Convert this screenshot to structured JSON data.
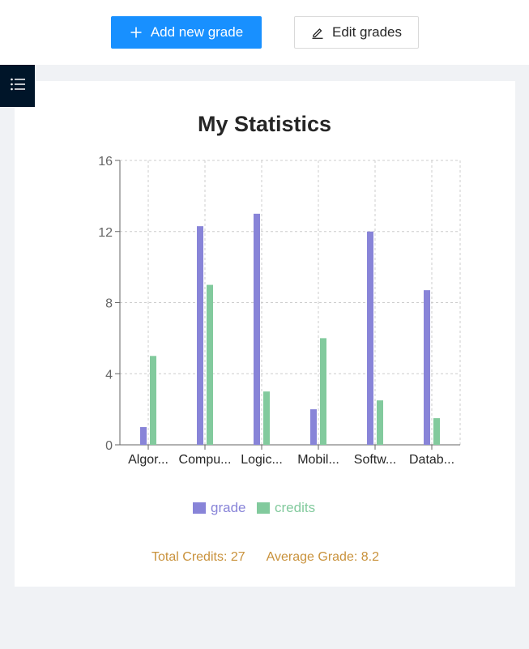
{
  "toolbar": {
    "add_label": "Add new grade",
    "edit_label": "Edit grades"
  },
  "colors": {
    "primary": "#1890ff",
    "sidebar": "#001529",
    "grade": "#8884d8",
    "credits": "#82ca9d",
    "stats": "#c9923c"
  },
  "chart_data": {
    "type": "bar",
    "title": "My Statistics",
    "categories": [
      "Algor...",
      "Compu...",
      "Logic...",
      "Mobil...",
      "Softw...",
      "Datab..."
    ],
    "series": [
      {
        "name": "grade",
        "values": [
          1,
          12.3,
          13,
          2,
          12,
          8.7
        ]
      },
      {
        "name": "credits",
        "values": [
          5,
          9,
          3,
          6,
          2.5,
          1.5
        ]
      }
    ],
    "ylim": [
      0,
      16
    ],
    "yticks": [
      0,
      4,
      8,
      12,
      16
    ],
    "grid": true,
    "legend": "bottom-center"
  },
  "stats": {
    "total_credits": "Total Credits: 27",
    "average_grade": "Average Grade: 8.2"
  }
}
